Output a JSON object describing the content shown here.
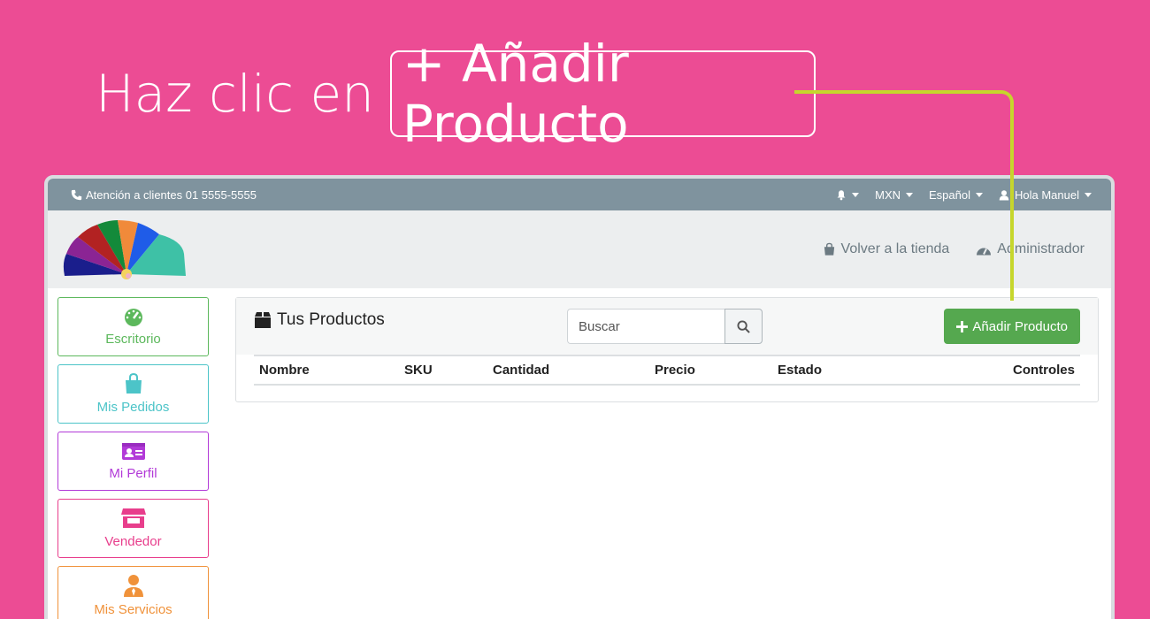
{
  "headline": {
    "prefix": "Haz clic en",
    "highlight": "+ Añadir Producto"
  },
  "topbar": {
    "contact": "Atención a clientes 01 5555-5555",
    "currency": "MXN",
    "language": "Español",
    "greeting": "Hola Manuel"
  },
  "header": {
    "back_to_store": "Volver a la tienda",
    "admin": "Administrador"
  },
  "sidebar": {
    "items": [
      {
        "label": "Escritorio",
        "color": "#5cb85c"
      },
      {
        "label": "Mis Pedidos",
        "color": "#4cc4c8"
      },
      {
        "label": "Mi Perfil",
        "color": "#b23ad8"
      },
      {
        "label": "Vendedor",
        "color": "#e83e8c"
      },
      {
        "label": "Mis Servicios",
        "color": "#f0923a"
      }
    ]
  },
  "panel": {
    "title": "Tus Productos",
    "search_placeholder": "Buscar",
    "add_button": "Añadir Producto",
    "columns": [
      "Nombre",
      "SKU",
      "Cantidad",
      "Precio",
      "Estado",
      "Controles"
    ]
  },
  "colors": {
    "background": "#ec4c94",
    "topbar": "#7f939e",
    "accent_green": "#55a84f",
    "connector": "#c6d62c"
  }
}
